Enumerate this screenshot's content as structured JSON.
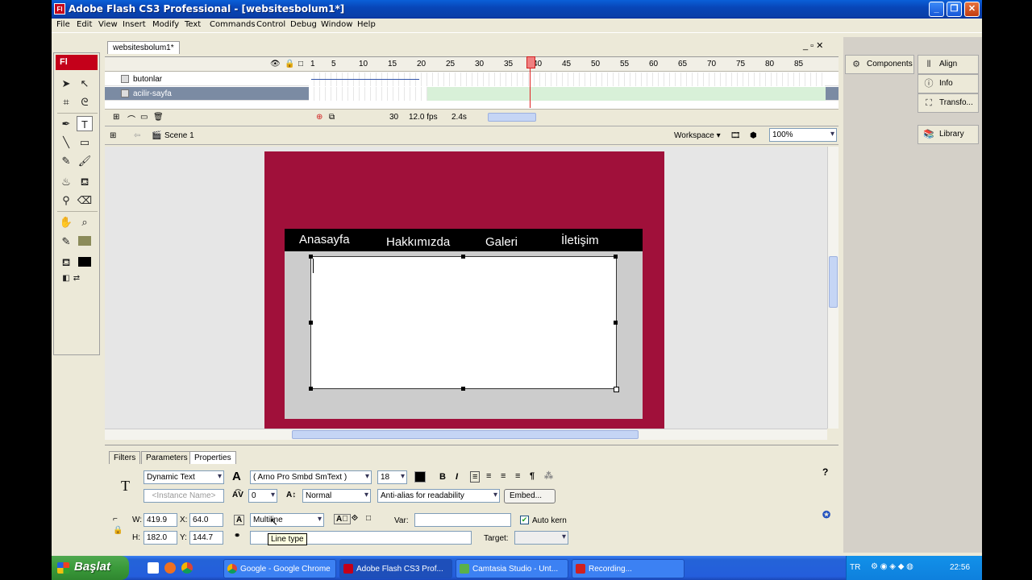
{
  "window": {
    "title": "Adobe Flash CS3 Professional - [websitesbolum1*]",
    "app_icon": "Fl"
  },
  "menu": [
    "File",
    "Edit",
    "View",
    "Insert",
    "Modify",
    "Text",
    "Commands",
    "Control",
    "Debug",
    "Window",
    "Help"
  ],
  "toolbox": {
    "header": "Fl"
  },
  "document": {
    "tab": "websitesbolum1*"
  },
  "timeline": {
    "ruler": [
      "1",
      "5",
      "10",
      "15",
      "20",
      "25",
      "30",
      "35",
      "40",
      "45",
      "50",
      "55",
      "60",
      "65",
      "70",
      "75",
      "80",
      "85"
    ],
    "layers": [
      "butonlar",
      "acilir-sayfa"
    ],
    "frame": "30",
    "fps": "12.0 fps",
    "time": "2.4s"
  },
  "editbar": {
    "scene": "Scene 1",
    "workspace": "Workspace ▾",
    "zoom": "100%"
  },
  "stage": {
    "nav": [
      "Anasayfa",
      "Hakkımızda",
      "Galeri",
      "İletişim"
    ]
  },
  "panels": {
    "components": "Components",
    "align": "Align",
    "info": "Info",
    "transform": "Transfo...",
    "library": "Library"
  },
  "properties": {
    "tabs": [
      "Filters",
      "Parameters",
      "Properties"
    ],
    "text_type": "Dynamic Text",
    "instance_placeholder": "<Instance Name>",
    "font": "( Arno Pro Smbd SmText )",
    "size": "18",
    "tracking": "0",
    "baseline": "Normal",
    "antialias": "Anti-alias for readability",
    "embed": "Embed...",
    "w": "419.9",
    "x": "64.0",
    "h": "182.0",
    "y": "144.7",
    "line_type": "Multiline",
    "var_label": "Var:",
    "auto_kern": "Auto kern",
    "target_label": "Target:",
    "tooltip": "Line type"
  },
  "taskbar": {
    "start": "Başlat",
    "tasks": [
      "Google - Google Chrome",
      "Adobe Flash CS3 Prof...",
      "Camtasia Studio - Unt...",
      "Recording..."
    ],
    "lang": "TR",
    "clock": "22:56"
  }
}
